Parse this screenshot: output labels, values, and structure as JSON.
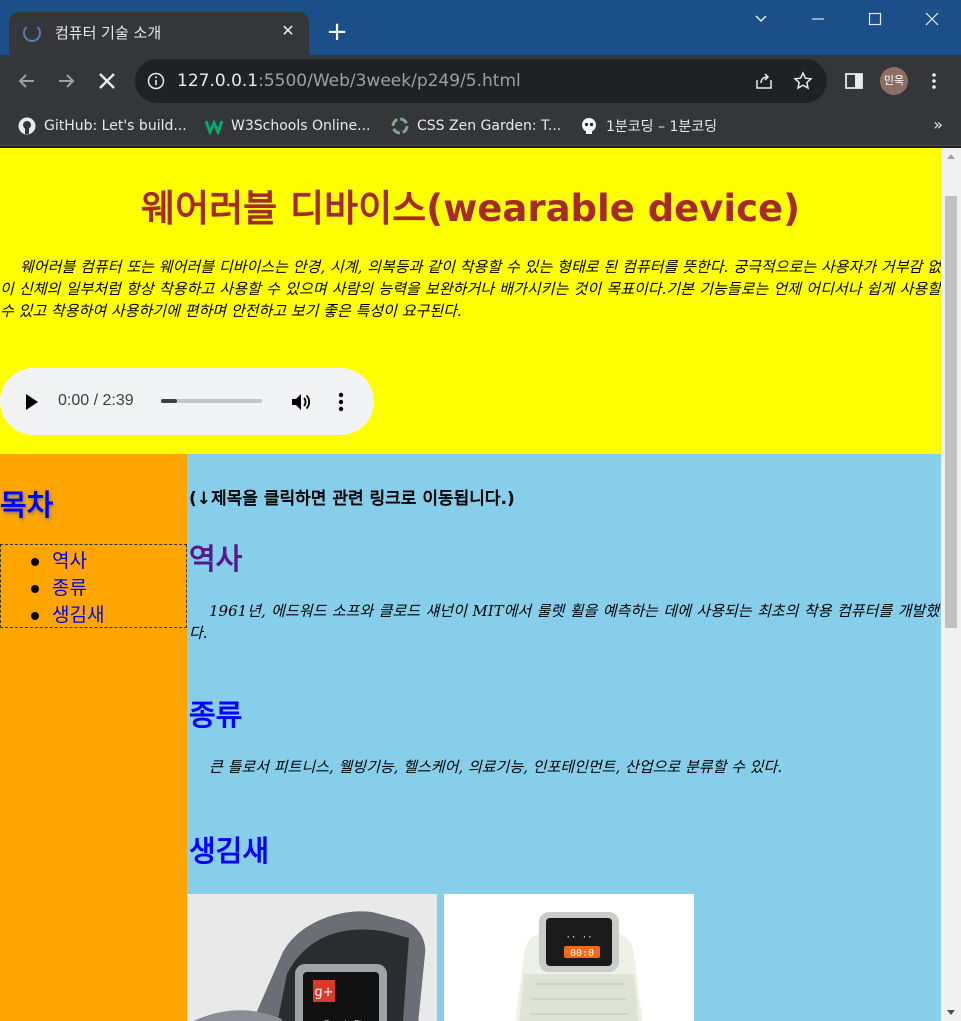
{
  "browser": {
    "tab_title": "컴퓨터 기술 소개",
    "url_host": "127.0.0.1",
    "url_path": ":5500/Web/3week/p249/5.html",
    "profile_label": "민욱",
    "bookmarks": [
      {
        "label": "GitHub: Let's build...",
        "icon": "github-icon"
      },
      {
        "label": "W3Schools Online...",
        "icon": "w3schools-icon"
      },
      {
        "label": "CSS Zen Garden: T...",
        "icon": "zen-garden-icon"
      },
      {
        "label": "1분코딩 – 1분코딩",
        "icon": "skull-icon"
      }
    ],
    "more_bookmarks": "»"
  },
  "page": {
    "title": "웨어러블 디바이스(wearable device)",
    "intro": "웨어러블 컴퓨터 또는 웨어러블 디바이스는 안경, 시계, 의복등과 같이 착용할 수 있는 형태로 된 컴퓨터를 뜻한다. 궁극적으로는 사용자가 거부감 없이 신체의 일부처럼 항상 착용하고 사용할 수 있으며 사람의 능력을 보완하거나 배가시키는 것이 목표이다.기본 기능들로는 언제 어디서나 쉽게 사용할 수 있고 착용하여 사용하기에 편하며 안전하고 보기 좋은 특성이 요구된다.",
    "audio": {
      "time": "0:00 / 2:39",
      "progress": 0.16
    },
    "toc": {
      "title": "목차",
      "items": [
        "역사",
        "종류",
        "생김새"
      ]
    },
    "hint": "(↓제목을 클릭하면 관련 링크로 이동됩니다.)",
    "sections": [
      {
        "heading": "역사",
        "text": "1961년, 에드워드 소프와 클로드 섀넌이 MIT에서 룰렛 휠을 예측하는 데에 사용되는 최초의 착용 컴퓨터를 개발했다."
      },
      {
        "heading": "종류",
        "text": "큰 틀로서 피트니스, 웰빙기능, 헬스케어, 의료기능, 인포테인먼트, 산업으로 분류할 수 있다."
      },
      {
        "heading": "생김새"
      }
    ],
    "colors": {
      "header_bg": "#ffff00",
      "title": "#a52a2a",
      "sidebar_bg": "#ffa500",
      "main_bg": "#87ceeb",
      "visited_heading": "#551a8b",
      "link_heading": "#0000ff"
    }
  }
}
